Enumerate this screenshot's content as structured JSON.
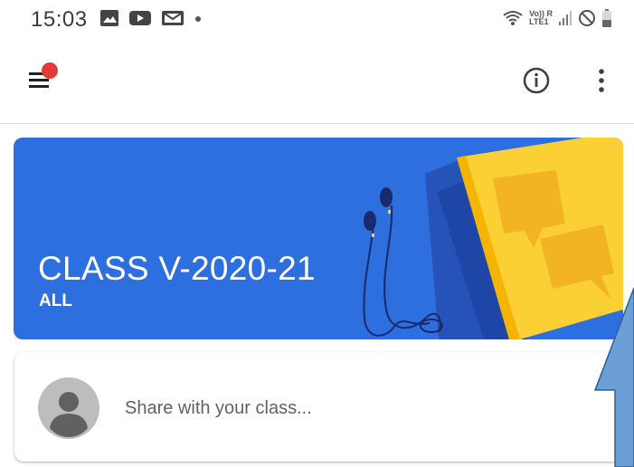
{
  "status_bar": {
    "time": "15:03",
    "icons_left": [
      "image-notification-icon",
      "youtube-notification-icon",
      "gmail-notification-icon",
      "more-notifications-dot-icon"
    ],
    "volte": "Vo)) R",
    "lte": "LTE1",
    "icons_right": [
      "wifi-icon",
      "volte-lte-icon",
      "signal-icon",
      "do-not-disturb-icon",
      "battery-icon"
    ]
  },
  "app_bar": {
    "icons": [
      "menu-icon",
      "info-icon",
      "more-vert-icon"
    ],
    "colors": {
      "notification_dot": "#e53935",
      "icon": "#3c4043"
    }
  },
  "class_banner": {
    "title": "CLASS V-2020-21",
    "subtitle": "ALL",
    "colors": {
      "background": "#2e6fe0",
      "book": "#fbd035",
      "text": "#ffffff"
    }
  },
  "share_card": {
    "placeholder": "Share with your class...",
    "avatar_icon": "default-avatar-icon"
  },
  "annotation": {
    "shape": "arrow",
    "color": "#6b9fd6"
  }
}
